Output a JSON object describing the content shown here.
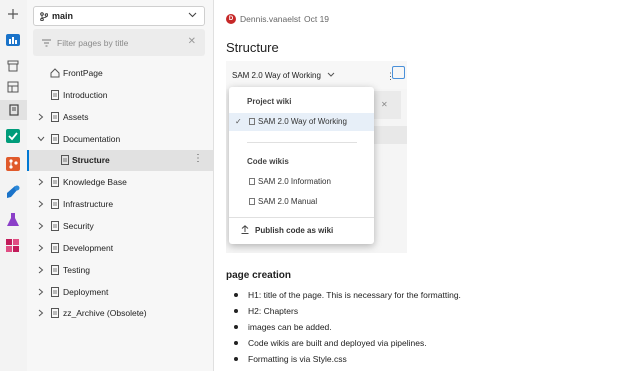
{
  "branch": {
    "name": "main"
  },
  "filter": {
    "placeholder": "Filter pages by title"
  },
  "tree": {
    "items": [
      {
        "label": "FrontPage"
      },
      {
        "label": "Introduction"
      },
      {
        "label": "Assets"
      },
      {
        "label": "Documentation"
      },
      {
        "label": "Structure"
      },
      {
        "label": "Knowledge Base"
      },
      {
        "label": "Infrastructure"
      },
      {
        "label": "Security"
      },
      {
        "label": "Development"
      },
      {
        "label": "Testing"
      },
      {
        "label": "Deployment"
      },
      {
        "label": "zz_Archive (Obsolete)"
      }
    ]
  },
  "page": {
    "author_initial": "D",
    "author": "Dennis.vanaelst",
    "date": "Oct 19",
    "title": "Structure"
  },
  "screenshot": {
    "selector": "SAM 2.0 Way of Working",
    "dropdown": {
      "project_header": "Project wiki",
      "project_items": [
        {
          "label": "SAM 2.0 Way of Working",
          "checked": true
        }
      ],
      "code_header": "Code wikis",
      "code_items": [
        {
          "label": "SAM 2.0 Information"
        },
        {
          "label": "SAM 2.0 Manual"
        }
      ],
      "publish": "Publish code as wiki"
    }
  },
  "section": {
    "heading": "page creation",
    "bullets": [
      "H1: title of the page. This is necessary for the formatting.",
      "H2: Chapters",
      "images can be added.",
      "Code wikis are built and deployed via pipelines.",
      "Formatting is via Style.css"
    ]
  },
  "colors": {
    "accent": "#0078d4",
    "avatar": "#c62828"
  }
}
